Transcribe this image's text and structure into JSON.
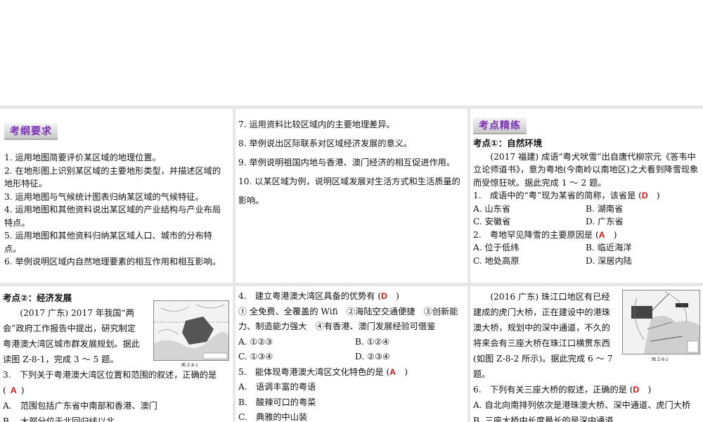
{
  "p1": {
    "tag": "考纲要求",
    "items": [
      "1. 运用地图简要评价某区域的地理位置。",
      "2. 在地形图上识别某区域的主要地形类型，并描述区域的地形特征。",
      "3. 运用地图与气候统计图表归纳某区域的气候特征。",
      "4. 运用地图和其他资料说出某区域的产业结构与产业布局特点。",
      "5. 运用地图和其他资料归纳某区域人口、城市的分布特点。",
      "6. 举例说明区域内自然地理要素的相互作用和相互影响。"
    ]
  },
  "p2": {
    "items": [
      "7. 运用资料比较区域内的主要地理差异。",
      "8. 举例说出区际联系对区域经济发展的意义。",
      "9. 举例说明祖国内地与香港、澳门经济的相互促进作用。",
      "10. 以某区域为例，说明区域发展对生活方式和生活质量的影响。"
    ]
  },
  "p3": {
    "tag": "考点精练",
    "heading": "考点①：自然环境",
    "intro": "(2017 福建) 成语“粤犬吠雪”出自唐代柳宗元《答韦中立论师道书》，意为粤地(今南岭以南地区)之犬看到降雪现象而受惊狂吠。据此完成 1 ～ 2 题。",
    "q1": {
      "text": "1.　成语中的“粤”现为某省的简称，该省是 (",
      "answer": "D",
      "close": ")",
      "options": [
        "A. 山东省",
        "B. 湖南省",
        "C. 安徽省",
        "D. 广东省"
      ]
    },
    "q2": {
      "text": "2.　粤地罕见降雪的主要原因是 (",
      "answer": "A",
      "close": ")",
      "options": [
        "A. 位于低纬",
        "B. 临近海洋",
        "C. 地处高原",
        "D. 深居内陆"
      ]
    }
  },
  "p4": {
    "heading": "考点②：经济发展",
    "intro": "(2017 广东) 2017 年我国“两会”政府工作报告中提出，研究制定粤港澳大湾区城市群发展规划。据此读图 Z-8-1，完成 3 ～ 5 题。",
    "figure_caption": "图 Z-8-1",
    "q3": {
      "text": "3.　下列关于粤港澳大湾区位置和范围的叙述，正确的是",
      "open": "(",
      "answer": "A",
      "close": ")",
      "options": [
        "A.　范围包括广东省中南部和香港、澳门",
        "B.　大部分位于北回归线以北"
      ]
    }
  },
  "p5": {
    "q4": {
      "text": "4.　建立粤港澳大湾区具备的优势有 (",
      "answer": "D",
      "close": ")",
      "statements": "① 全免费、全覆盖的 Wifi　②海陆空交通便捷　③创新能力、制造能力强大　④有香港、澳门发展经验可借鉴",
      "options": [
        "A. ①②③",
        "B. ①②④",
        "C. ①③④",
        "D. ②③④"
      ]
    },
    "q5": {
      "text": "5.　能体现粤港澳大湾区文化特色的是 (",
      "answer": "A",
      "close": ")",
      "options": [
        "A.　语调丰富的粤语",
        "B.　酸辣可口的粤菜",
        "C.　典雅的中山装"
      ]
    }
  },
  "p6": {
    "intro": "(2016 广东) 珠江口地区有已经建成的虎门大桥，正在建设中的港珠澳大桥，规划中的深中通道，不久的将来会有三座大桥在珠江口横贯东西(如图 Z-8-2 所示)。据此完成 6 ～ 7 题。",
    "figure_caption": "图 Z-8-2",
    "q6": {
      "text": "6.　下列有关三座大桥的叙述，正确的是 (",
      "answer": "D",
      "close": ")",
      "options": [
        "A. 自北向南排列依次是港珠澳大桥、深中通道、虎门大桥",
        "B. 三座大桥中长度最长的是深中通道"
      ]
    }
  }
}
